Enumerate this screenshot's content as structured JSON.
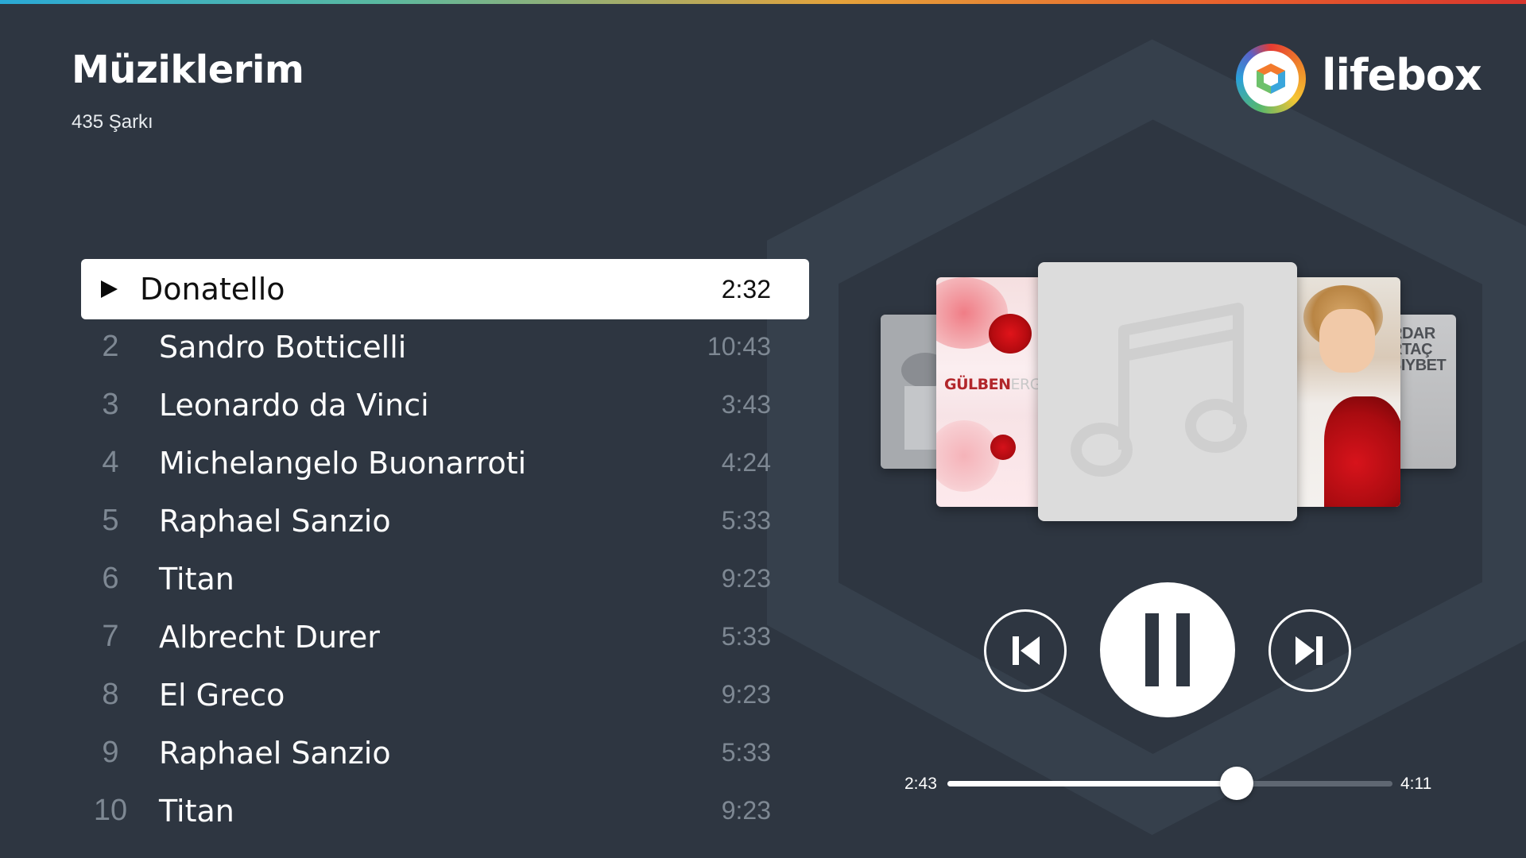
{
  "header": {
    "title": "Müziklerim",
    "subtitle": "435 Şarkı",
    "logo_text": "lifebox"
  },
  "tracks": [
    {
      "number": "",
      "title": "Donatello",
      "duration": "2:32",
      "playing": true
    },
    {
      "number": "2",
      "title": "Sandro Botticelli",
      "duration": "10:43"
    },
    {
      "number": "3",
      "title": "Leonardo da Vinci",
      "duration": "3:43"
    },
    {
      "number": "4",
      "title": "Michelangelo Buonarroti",
      "duration": "4:24"
    },
    {
      "number": "5",
      "title": "Raphael Sanzio",
      "duration": "5:33"
    },
    {
      "number": "6",
      "title": "Titan",
      "duration": "9:23"
    },
    {
      "number": "7",
      "title": "Albrecht Durer",
      "duration": "5:33"
    },
    {
      "number": "8",
      "title": "El Greco",
      "duration": "9:23"
    },
    {
      "number": "9",
      "title": "Raphael Sanzio",
      "duration": "5:33"
    },
    {
      "number": "10",
      "title": "Titan",
      "duration": "9:23"
    }
  ],
  "covers": {
    "left_text_bold": "GÜLBEN",
    "left_text_faded": "ERG",
    "far_right_text": [
      "RDAR",
      "RTAÇ",
      "SIYBET"
    ]
  },
  "player": {
    "current_time": "2:43",
    "total_time": "4:11",
    "progress_fraction": 0.65,
    "state": "playing"
  },
  "icons": {
    "play": "play-icon",
    "previous": "skip-previous-icon",
    "pause": "pause-icon",
    "next": "skip-next-icon",
    "placeholder": "music-note-icon"
  },
  "colors": {
    "background": "#2e3641",
    "active_row": "#ffffff",
    "muted_text": "#7e8893"
  }
}
